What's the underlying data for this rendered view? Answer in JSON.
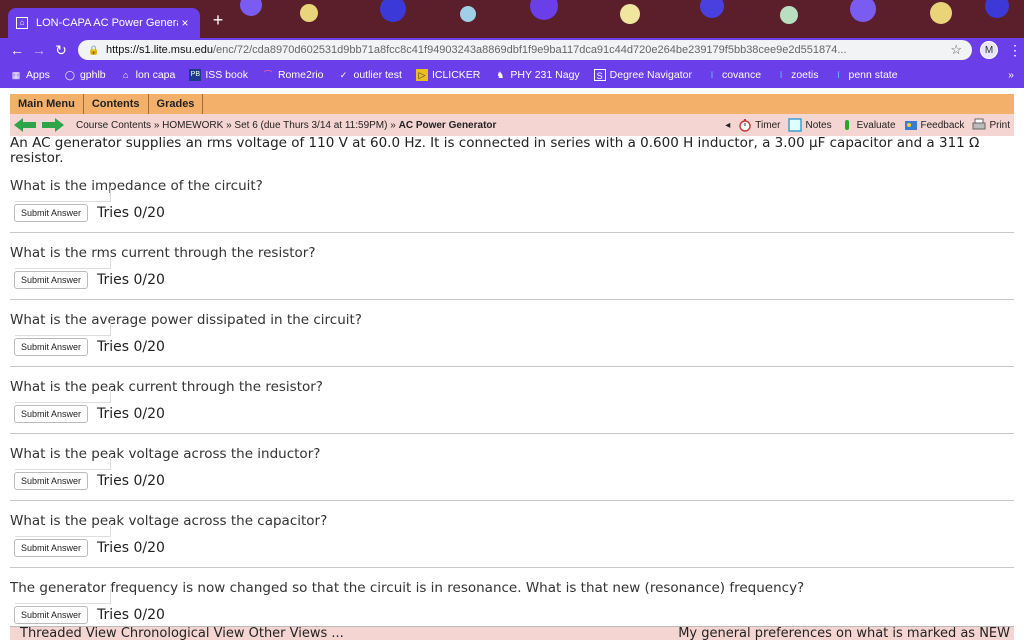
{
  "browser": {
    "tab_title": "LON-CAPA AC Power Generato",
    "tab_close": "×",
    "new_tab": "+",
    "url_host": "https://s1.lite.msu.edu",
    "url_path": "/enc/72/cda8970d602531d9bb71a8fcc8c41f94903243a8869dbf1f9e9ba117dca91c44d720e264be239179f5bb38cee9e2d551874...",
    "profile_initial": "M",
    "bookmarks": [
      {
        "label": "Apps",
        "icon": "apps-grid-icon"
      },
      {
        "label": "gphlb",
        "icon": "globe-icon"
      },
      {
        "label": "lon capa",
        "icon": "loncapa-icon"
      },
      {
        "label": "ISS book",
        "icon": "pb-icon"
      },
      {
        "label": "Rome2rio",
        "icon": "rome2rio-icon"
      },
      {
        "label": "outlier test",
        "icon": "check-icon"
      },
      {
        "label": "ICLICKER",
        "icon": "iclicker-icon"
      },
      {
        "label": "PHY 231 Nagy",
        "icon": "msu-icon"
      },
      {
        "label": "Degree Navigator",
        "icon": "s-icon"
      },
      {
        "label": "covance",
        "icon": "i-icon"
      },
      {
        "label": "zoetis",
        "icon": "i-icon"
      },
      {
        "label": "penn state",
        "icon": "i-icon"
      }
    ],
    "bookmarks_more": "»"
  },
  "menu": {
    "main": "Main Menu",
    "contents": "Contents",
    "grades": "Grades"
  },
  "nav": {
    "crumb1": "Course Contents",
    "crumb2": "HOMEWORK",
    "crumb3": "Set 6 (due Thurs 3/14 at 11:59PM)",
    "crumb4": "AC Power Generator",
    "sep": "»",
    "tools": {
      "timer": "Timer",
      "notes": "Notes",
      "evaluate": "Evaluate",
      "feedback": "Feedback",
      "print": "Print"
    }
  },
  "problem_text": "An AC generator supplies an rms voltage of 110 V at 60.0 Hz. It is connected in series with a 0.600 H inductor, a 3.00 μF capacitor and a 311 Ω resistor.",
  "questions": [
    {
      "text": "What is the impedance of the circuit?",
      "submit": "Submit Answer",
      "tries": "Tries 0/20"
    },
    {
      "text": "What is the rms current through the resistor?",
      "submit": "Submit Answer",
      "tries": "Tries 0/20"
    },
    {
      "text": "What is the average power dissipated in the circuit?",
      "submit": "Submit Answer",
      "tries": "Tries 0/20"
    },
    {
      "text": "What is the peak current through the resistor?",
      "submit": "Submit Answer",
      "tries": "Tries 0/20"
    },
    {
      "text": "What is the peak voltage across the inductor?",
      "submit": "Submit Answer",
      "tries": "Tries 0/20"
    },
    {
      "text": "What is the peak voltage across the capacitor?",
      "submit": "Submit Answer",
      "tries": "Tries 0/20"
    },
    {
      "text": "The generator frequency is now changed so that the circuit is in resonance. What is that new (resonance) frequency?",
      "submit": "Submit Answer",
      "tries": "Tries 0/20"
    }
  ],
  "footer": {
    "left": "Threaded View  Chronological View  Other Views ...",
    "right": "My general preferences on what is marked as NEW"
  },
  "colors": {
    "browser_accent": "#6a3ee8",
    "menu_bar": "#f2b06a",
    "nav_bar": "#f4d5d2"
  }
}
